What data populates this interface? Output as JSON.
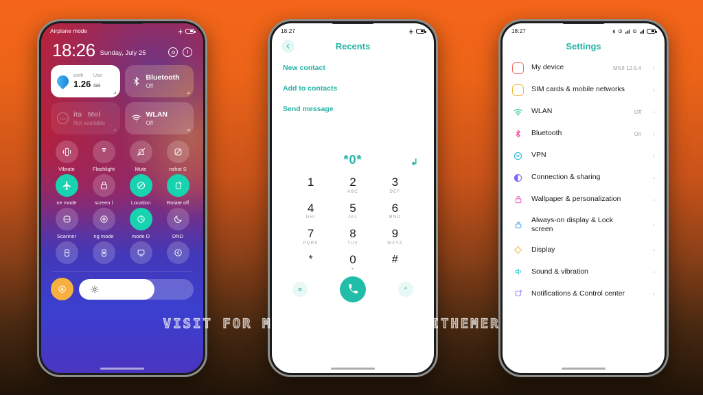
{
  "watermark": "VISIT FOR MORE THEMES - MIUITHEMER.COM",
  "background": {
    "top_color": "#F4651A",
    "bottom_color": "#201408"
  },
  "accent": {
    "teal": "#27b3a6",
    "amber": "#f5b041"
  },
  "phone1": {
    "statusbar": {
      "left": "Airplane mode",
      "airplane_icon": "airplane-icon",
      "battery_icon": "battery-icon"
    },
    "clock": {
      "time": "18:26",
      "date": "Sunday, July 25",
      "gear_icon": "gear-icon",
      "history_icon": "history-icon"
    },
    "cards": [
      {
        "name": "data-usage",
        "top_left": "onth",
        "top_right": "Use",
        "value": "1.26",
        "unit": "GB",
        "icon": "water-drop-icon"
      },
      {
        "name": "bluetooth",
        "title": "Bluetooth",
        "sub": "Off",
        "icon": "bluetooth-icon"
      },
      {
        "name": "mobile-data",
        "title": "Mol",
        "top_left": "ita",
        "sub": "Not available",
        "icon": "no-data-icon"
      },
      {
        "name": "wlan",
        "title": "WLAN",
        "sub": "Off",
        "icon": "wifi-icon"
      }
    ],
    "tiles": [
      [
        {
          "label": "Vibrate",
          "icon": "vibrate-icon",
          "on": false
        },
        {
          "label": "Flashlight",
          "icon": "flashlight-icon",
          "on": false
        },
        {
          "label": "Mute",
          "icon": "mute-icon",
          "on": false
        },
        {
          "label": "nshot   S",
          "icon": "screenshot-icon",
          "on": false
        }
      ],
      [
        {
          "label": "ne mode",
          "icon": "airplane-icon",
          "on": true
        },
        {
          "label": "screen    l",
          "icon": "lock-icon",
          "on": false
        },
        {
          "label": "Location",
          "icon": "location-off-icon",
          "on": true
        },
        {
          "label": "Rotate off",
          "icon": "rotate-icon",
          "on": true
        }
      ],
      [
        {
          "label": "Scanner",
          "icon": "scanner-icon",
          "on": false
        },
        {
          "label": "ng mode",
          "icon": "reading-mode-icon",
          "on": false
        },
        {
          "label": "mode    D",
          "icon": "dark-mode-icon",
          "on": true
        },
        {
          "label": "DND",
          "icon": "dnd-icon",
          "on": false
        }
      ],
      [
        {
          "label": "",
          "icon": "battery-saver-icon",
          "on": false
        },
        {
          "label": "",
          "icon": "ultra-battery-icon",
          "on": false
        },
        {
          "label": "",
          "icon": "cast-icon",
          "on": false
        },
        {
          "label": "",
          "icon": "second-space-icon",
          "on": false
        }
      ]
    ],
    "brightness": {
      "button_icon": "auto-brightness-icon",
      "slider_icon": "sun-icon",
      "level_percent": 66
    }
  },
  "phone2": {
    "statusbar": {
      "time": "18:27",
      "airplane_icon": "airplane-icon",
      "battery_icon": "battery-icon"
    },
    "title": "Recents",
    "back_icon": "chevron-left-icon",
    "actions": [
      "New contact",
      "Add to contacts",
      "Send message"
    ],
    "number": "*0*",
    "delete_icon": "backspace-icon",
    "keys": [
      {
        "digit": "1",
        "letters": " "
      },
      {
        "digit": "2",
        "letters": "ABC"
      },
      {
        "digit": "3",
        "letters": "DEF"
      },
      {
        "digit": "4",
        "letters": "GHI"
      },
      {
        "digit": "5",
        "letters": "JKL"
      },
      {
        "digit": "6",
        "letters": "MNO"
      },
      {
        "digit": "7",
        "letters": "PQRS"
      },
      {
        "digit": "8",
        "letters": "TUV"
      },
      {
        "digit": "9",
        "letters": "WXYZ"
      },
      {
        "digit": "*",
        "letters": ""
      },
      {
        "digit": "0",
        "letters": "+"
      },
      {
        "digit": "#",
        "letters": ""
      }
    ],
    "bottom": {
      "left_icon": "keypad-menu-icon",
      "left_label": "≡",
      "call_icon": "call-icon",
      "right_icon": "chevron-up-icon",
      "right_label": "^"
    }
  },
  "phone3": {
    "statusbar": {
      "time": "18:27",
      "icons": "bluetooth alarm signal1 alarm signal2 battery"
    },
    "title": "Settings",
    "rows": [
      {
        "label": "My device",
        "value": "MIUI 12.5.4",
        "icon": "device-icon",
        "color": "#f26b5b"
      },
      {
        "label": "SIM cards & mobile networks",
        "value": "",
        "icon": "sim-icon",
        "color": "#f3b73c"
      },
      {
        "label": "WLAN",
        "value": "Off",
        "icon": "wifi-icon",
        "color": "#2fc4a0"
      },
      {
        "label": "Bluetooth",
        "value": "On",
        "icon": "bluetooth-icon",
        "color": "#ef4ba0"
      },
      {
        "label": "VPN",
        "value": "",
        "icon": "vpn-icon",
        "color": "#2bb8d6"
      },
      {
        "label": "Connection & sharing",
        "value": "",
        "icon": "connection-icon",
        "color": "#7a6bf0"
      },
      {
        "label": "Wallpaper & personalization",
        "value": "",
        "icon": "wallpaper-icon",
        "color": "#f062b8"
      },
      {
        "label": "Always-on display & Lock screen",
        "value": "",
        "icon": "lockscreen-icon",
        "color": "#5aa9f0"
      },
      {
        "label": "Display",
        "value": "",
        "icon": "display-icon",
        "color": "#f3b73c"
      },
      {
        "label": "Sound & vibration",
        "value": "",
        "icon": "sound-icon",
        "color": "#45c7d6"
      },
      {
        "label": "Notifications & Control center",
        "value": "",
        "icon": "notifications-icon",
        "color": "#8f7df0"
      }
    ]
  }
}
